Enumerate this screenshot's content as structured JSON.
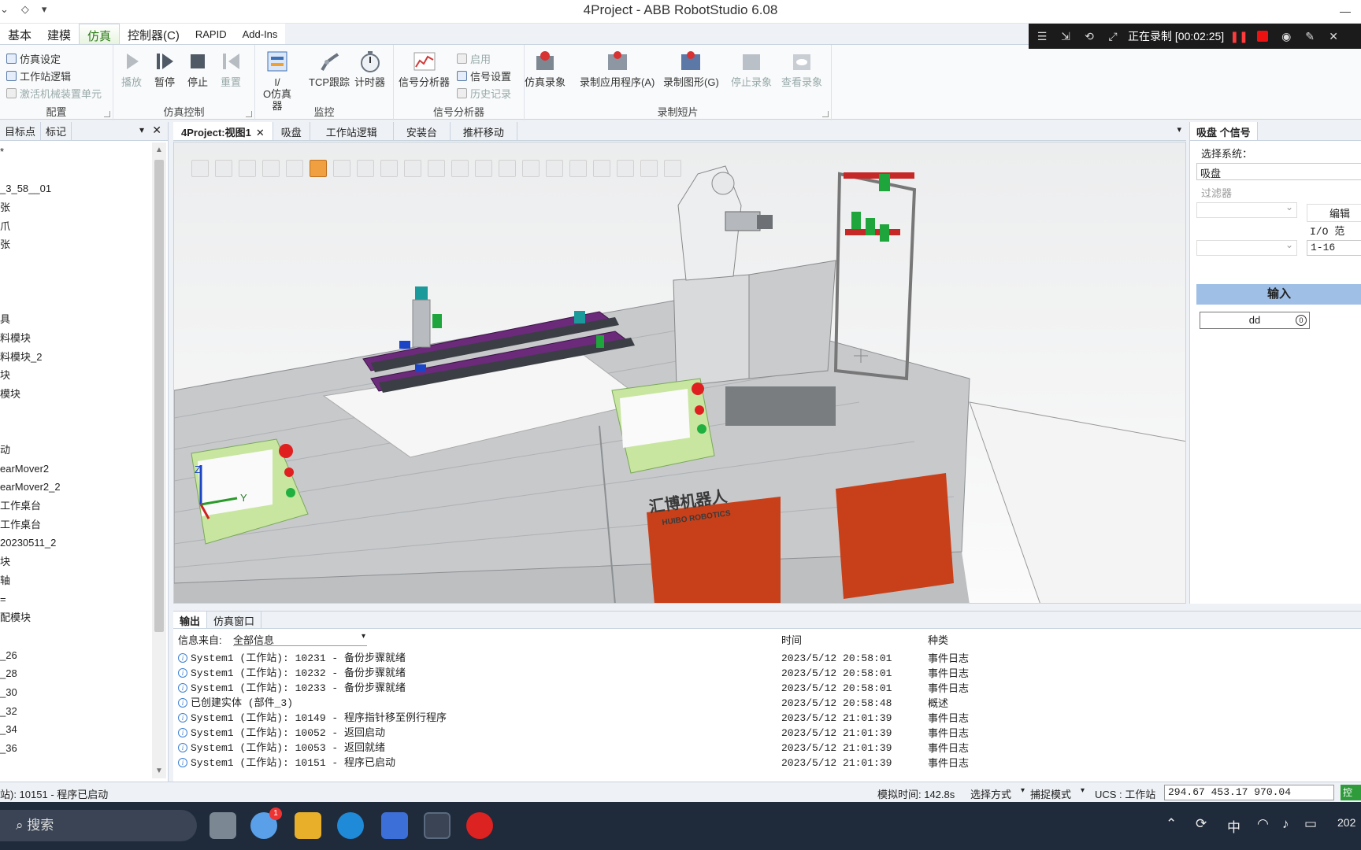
{
  "window": {
    "title": "4Project - ABB RobotStudio 6.08"
  },
  "recording": {
    "status": "正在录制 [00:02:25]"
  },
  "ribbon_tabs": [
    {
      "label": "基本"
    },
    {
      "label": "建模"
    },
    {
      "label": "仿真",
      "active": true
    },
    {
      "label": "控制器(C)"
    },
    {
      "label": "RAPID"
    },
    {
      "label": "Add-Ins"
    }
  ],
  "ribbon": {
    "config": {
      "label": "配置",
      "sim_setup": "仿真设定",
      "station_logic": "工作站逻辑",
      "activate_unit": "激活机械装置单元"
    },
    "sim_control": {
      "label": "仿真控制",
      "play": "播放",
      "pause": "暂停",
      "stop": "停止",
      "reset": "重置"
    },
    "monitor": {
      "label": "监控",
      "io_sim_1": "I/",
      "io_sim_2": "O仿真器",
      "tcp_trace": "TCP跟踪",
      "timer": "计时器"
    },
    "signal_analyzer": {
      "label": "信号分析器",
      "analyzer": "信号分析器",
      "enable": "启用",
      "signal_setup": "信号设置",
      "history": "历史记录"
    },
    "recording": {
      "label": "录制短片",
      "sim_record": "仿真录象",
      "record_app": "录制应用程序(A)",
      "record_graphics": "录制图形(G)",
      "stop_record": "停止录象",
      "view_record": "查看录象"
    }
  },
  "left_panel": {
    "tabs": [
      "目标点",
      "标记"
    ],
    "items": [
      "*",
      "",
      "_3_58__01",
      "张",
      "爪",
      "张",
      "",
      "",
      "",
      "具",
      "料模块",
      "料模块_2",
      "块",
      "模块",
      "",
      "",
      "动",
      "earMover2",
      "earMover2_2",
      "工作桌台",
      "工作桌台",
      "20230511_2",
      "块",
      "轴",
      "=",
      "配模块",
      "",
      "_26",
      "_28",
      "_30",
      "_32",
      "_34",
      "_36"
    ]
  },
  "view_tabs": [
    {
      "label": "4Project:视图1",
      "active": true,
      "closable": true
    },
    {
      "label": "吸盘"
    },
    {
      "label": "工作站逻辑"
    },
    {
      "label": "安装台"
    },
    {
      "label": "推杆移动"
    }
  ],
  "viewport": {
    "brand_cn": "汇博机器人",
    "brand_en": "HUIBO ROBOTICS",
    "axis_y": "Y",
    "axis_z": "Z"
  },
  "right_panel": {
    "tab": "吸盘 个信号",
    "select_system_label": "选择系统：",
    "system_value": "吸盘",
    "filter_label": "过滤器",
    "edit_label": "编辑",
    "io_range_label": "I/O 范",
    "io_range_value": "1-16",
    "input_header": "输入",
    "signal_name": "dd",
    "signal_value": "0"
  },
  "output": {
    "tabs": [
      {
        "label": "输出",
        "active": true
      },
      {
        "label": "仿真窗口"
      }
    ],
    "filter_label": "信息来自:",
    "filter_value": "全部信息",
    "col_time": "时间",
    "col_category": "种类",
    "rows": [
      {
        "msg": "System1 (工作站): 10231 - 备份步骤就绪",
        "time": "2023/5/12 20:58:01",
        "cat": "事件日志"
      },
      {
        "msg": "System1 (工作站): 10232 - 备份步骤就绪",
        "time": "2023/5/12 20:58:01",
        "cat": "事件日志"
      },
      {
        "msg": "System1 (工作站): 10233 - 备份步骤就绪",
        "time": "2023/5/12 20:58:01",
        "cat": "事件日志"
      },
      {
        "msg": "已创建实体 (部件_3)",
        "time": "2023/5/12 20:58:48",
        "cat": "概述"
      },
      {
        "msg": "System1 (工作站): 10149 - 程序指针移至例行程序",
        "time": "2023/5/12 21:01:39",
        "cat": "事件日志"
      },
      {
        "msg": "System1 (工作站): 10052 - 返回启动",
        "time": "2023/5/12 21:01:39",
        "cat": "事件日志"
      },
      {
        "msg": "System1 (工作站): 10053 - 返回就绪",
        "time": "2023/5/12 21:01:39",
        "cat": "事件日志"
      },
      {
        "msg": "System1 (工作站): 10151 - 程序已启动",
        "time": "2023/5/12 21:01:39",
        "cat": "事件日志"
      }
    ]
  },
  "status_bar": {
    "message": "站): 10151 - 程序已启动",
    "sim_time": "模拟时间: 142.8s",
    "select_mode": "选择方式",
    "snap_mode": "捕捉模式",
    "ucs": "UCS : 工作站",
    "coords": "294.67   453.17   970.04",
    "controller": "控制"
  },
  "taskbar": {
    "search": "搜索",
    "badge": "1",
    "lang": "中",
    "clock": "202"
  },
  "colors": {
    "accent_green": "#2a7a17",
    "signal_header": "#9fbfe6",
    "record_red": "#ee1111",
    "panel_red": "#c8401a"
  }
}
